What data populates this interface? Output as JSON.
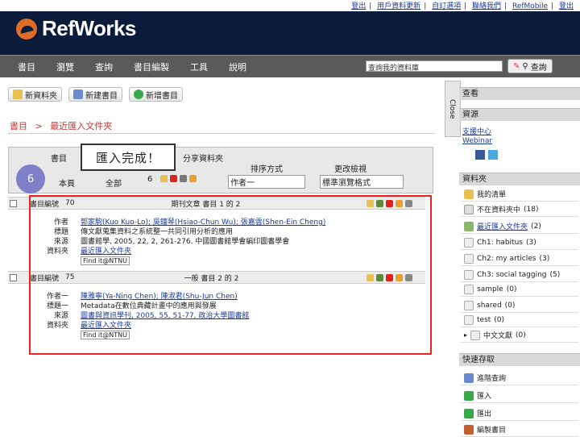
{
  "top_links": [
    "登出",
    "|",
    "用戶資料更新",
    "|",
    "自訂選項",
    "|",
    "聯絡我們",
    "|",
    "RefMobile",
    "|",
    "登出"
  ],
  "logo": "RefWorks",
  "menu": [
    "書目",
    "瀏覽",
    "查詢",
    "書目編製",
    "工具",
    "說明"
  ],
  "search": {
    "value": "查詢我的資料庫",
    "button": "查詢"
  },
  "toolbar": {
    "new_folder": "新資料夾",
    "new_ref": "新建書目",
    "add_ref": "新增書目"
  },
  "breadcrumb": {
    "root": "書目",
    "sep": ">",
    "current": "最近匯入文件夾"
  },
  "tabs": {
    "tab1": "書目",
    "tab2": "分享資料夾",
    "sort_label": "排序方式",
    "sort_value": "作者一",
    "view_label": "更改檢視",
    "view_value": "標準瀏覽格式",
    "count": "6",
    "page_opt": "本頁",
    "all_opt": "全部"
  },
  "callout": "匯入完成！",
  "circle_number": "6",
  "right_rail_close": "Close",
  "records": [
    {
      "id_label": "書目編號",
      "id": "70",
      "type_line": "期刊文章 書目 1 的 2",
      "rows": [
        {
          "label": "作者",
          "value": "郭家駒(Kuo Kuo-Lo); 吳鐘琴(Hsiao-Chun Wu); 張嘉雲(Shen-Ein Cheng)"
        },
        {
          "label": "標題",
          "value": "傳文獻蒐集資料之系統整一共同引用分析的應用"
        },
        {
          "label": "來源",
          "value": "圖書館學, 2005, 22, 2, 261-276. 中國圖書館學會編印圖書學會"
        },
        {
          "label": "資料夾",
          "value": "最近匯入文件夾"
        }
      ],
      "findit": "Find it@NTNU"
    },
    {
      "id_label": "書目編號",
      "id": "75",
      "type_line": "一般 書目 2 的 2",
      "rows": [
        {
          "label": "作者一",
          "value": "陳雅寧(Ya-Ning Chen); 陳淑君(Shu-Jun Chen)"
        },
        {
          "label": "標題一",
          "value": "Metadata在數位典藏計畫中的應用與發展"
        },
        {
          "label": "來源",
          "value": "圖書與資訊學刊, 2005, 55, 51-77, 政治大學圖書館"
        },
        {
          "label": "資料夾",
          "value": "最近匯入文件夾"
        }
      ],
      "findit": "Find it@NTNU"
    }
  ],
  "sidebar": {
    "header1": "查看",
    "header2": "資源",
    "resource_links": [
      "支援中心",
      "Webinar"
    ],
    "folders_header": "資料夾",
    "folders": [
      {
        "name": "我的清單",
        "count": ""
      },
      {
        "name": "不在資料夾中",
        "count": "(18)"
      },
      {
        "name": "最近匯入文件夾",
        "count": "(2)"
      },
      {
        "name": "Ch1: habitus",
        "count": "(3)"
      },
      {
        "name": "Ch2: my articles",
        "count": "(3)"
      },
      {
        "name": "Ch3: social tagging",
        "count": "(5)"
      },
      {
        "name": "sample",
        "count": "(0)"
      },
      {
        "name": "shared",
        "count": "(0)"
      },
      {
        "name": "test",
        "count": "(0)"
      },
      {
        "name": "中文文獻",
        "count": "(0)"
      }
    ],
    "quick_header": "快速存取",
    "quick": [
      "進階查詢",
      "匯入",
      "匯出",
      "編製書目"
    ]
  }
}
